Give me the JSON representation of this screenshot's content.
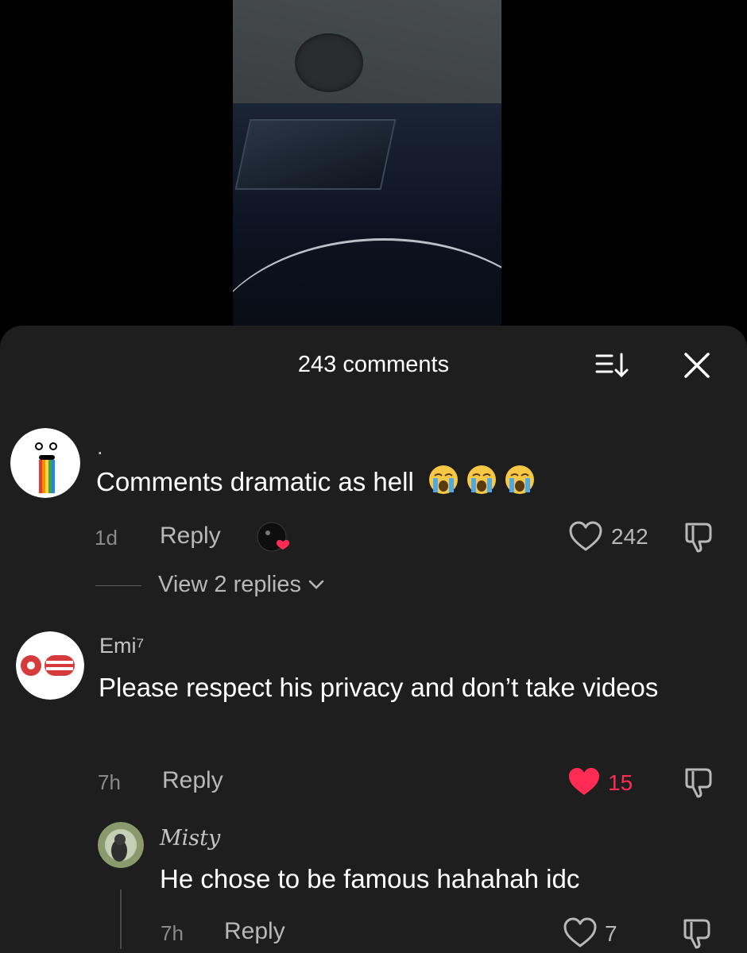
{
  "header": {
    "title": "243 comments"
  },
  "comments": [
    {
      "username": ".",
      "text": "Comments dramatic as hell",
      "emoji": "loudly-crying-face",
      "time": "1d",
      "reply_label": "Reply",
      "likes": "242",
      "liked": false,
      "view_replies": "View 2 replies"
    },
    {
      "username": "Emi⁷",
      "text": "Please respect his privacy and don’t take videos",
      "time": "7h",
      "reply_label": "Reply",
      "likes": "15",
      "liked": true
    },
    {
      "username": "Misty",
      "text": "He chose to be famous hahahah idc",
      "time": "7h",
      "reply_label": "Reply",
      "likes": "7",
      "liked": false
    }
  ],
  "colors": {
    "like_active": "#fe2c55",
    "sheet_bg": "#1e1e1e"
  }
}
